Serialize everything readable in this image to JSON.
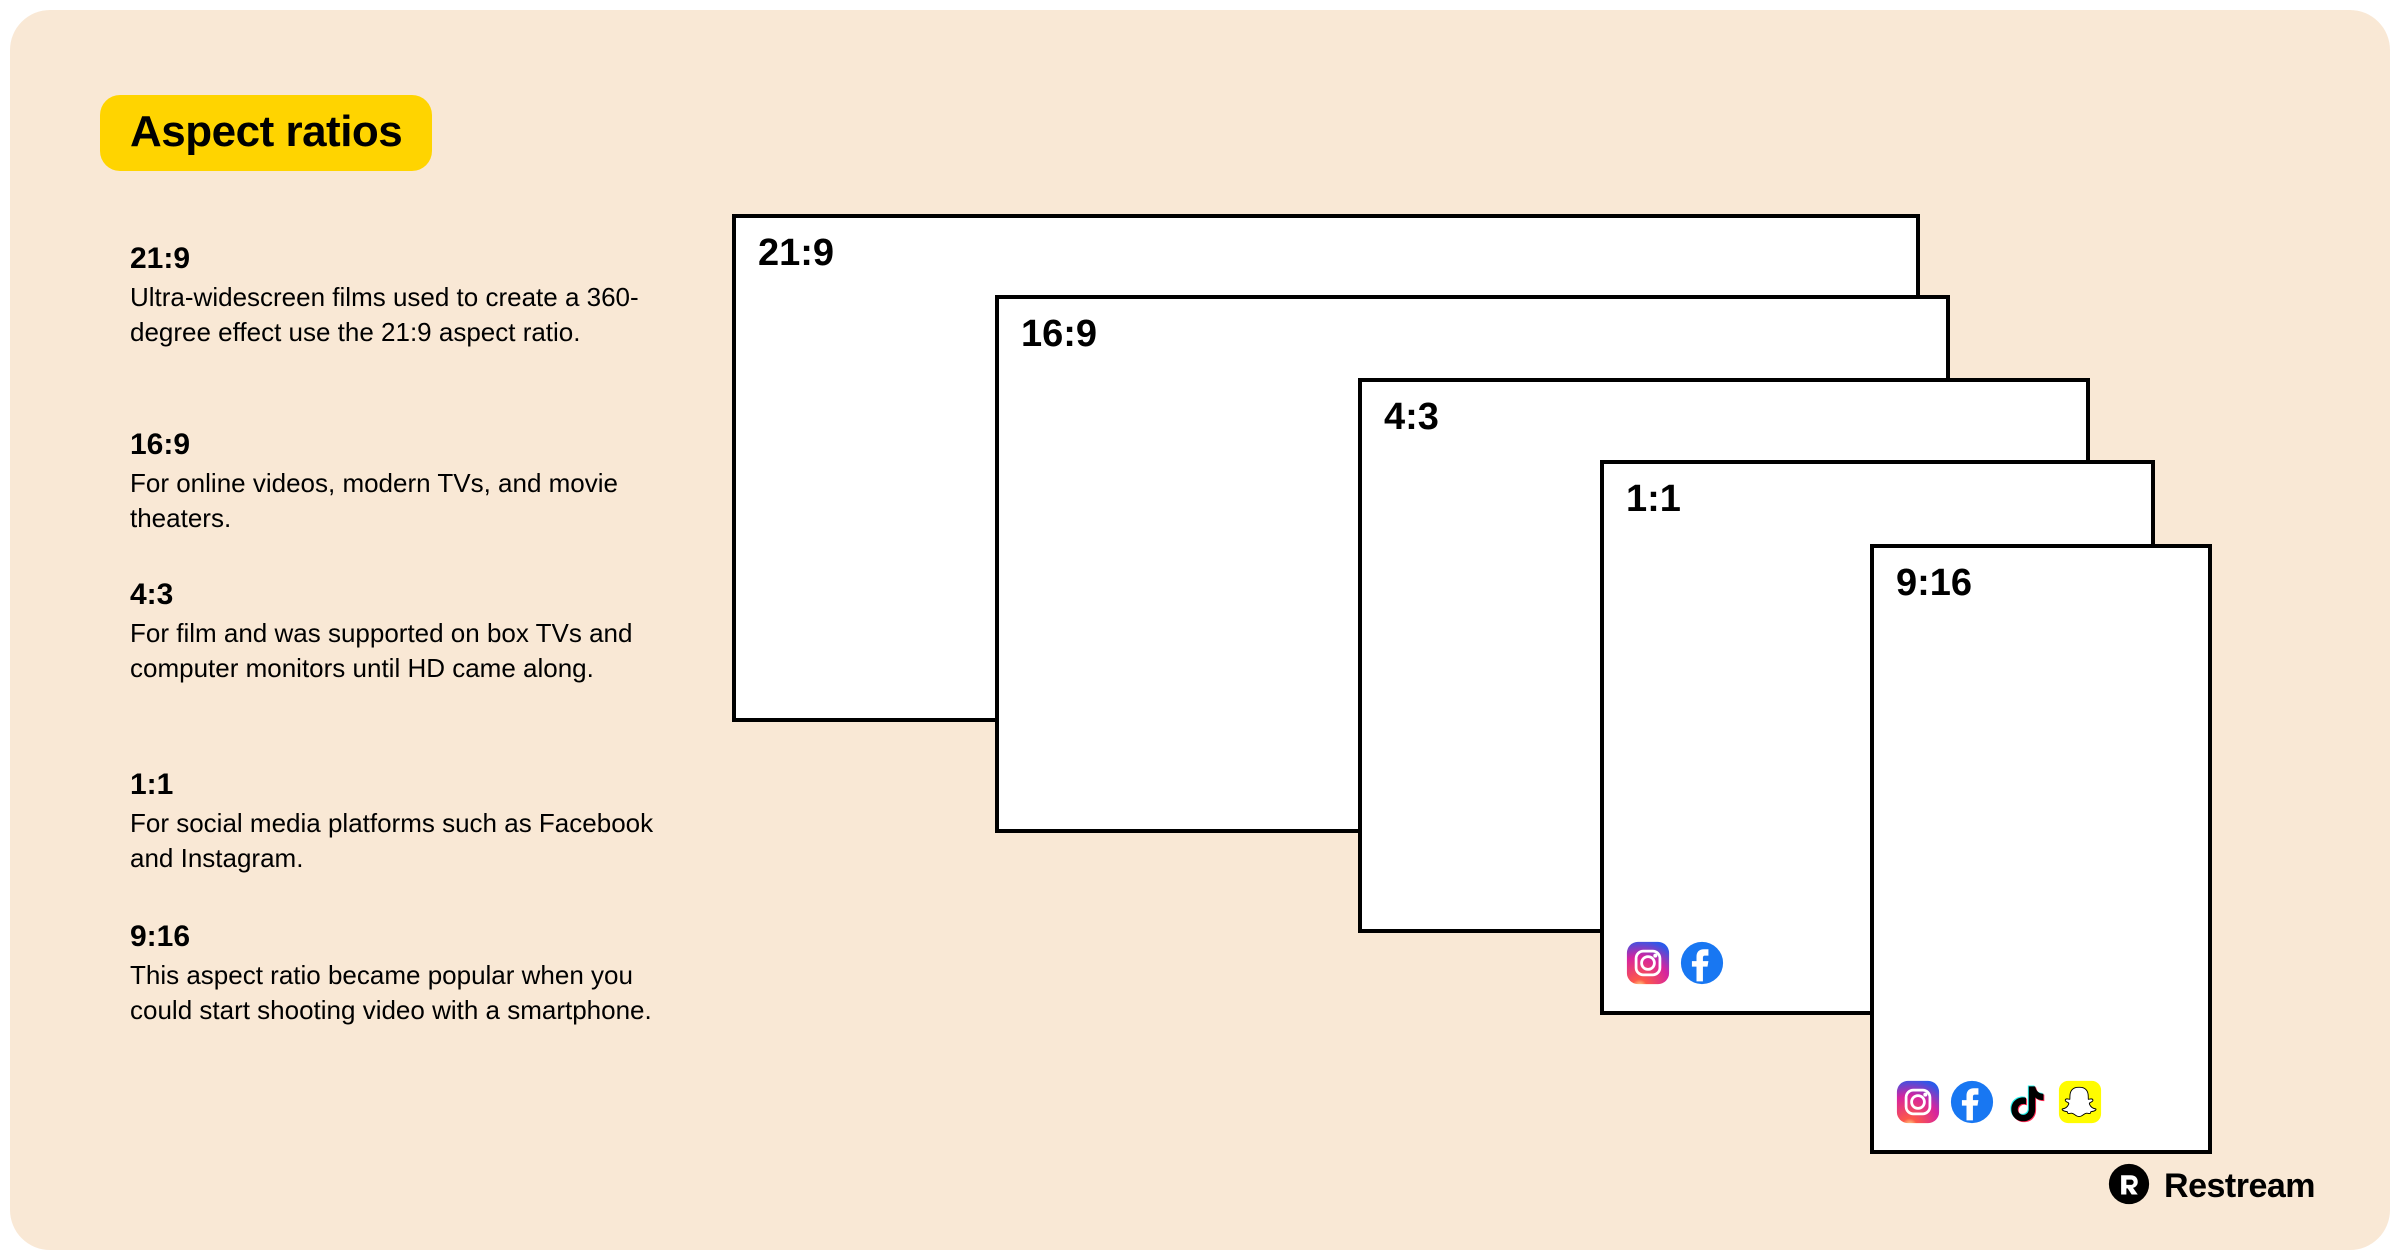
{
  "title": "Aspect ratios",
  "descriptions": [
    {
      "title": "21:9",
      "text": "Ultra-widescreen films used to create a 360-degree effect use the 21:9 aspect ratio."
    },
    {
      "title": "16:9",
      "text": "For online videos, modern TVs, and movie theaters."
    },
    {
      "title": "4:3",
      "text": "For film and was supported on box TVs and computer monitors until HD came along."
    },
    {
      "title": "1:1",
      "text": "For social media platforms such as Facebook and Instagram."
    },
    {
      "title": "9:16",
      "text": "This aspect ratio became popular when you could start shooting video with a smartphone."
    }
  ],
  "boxes": {
    "b0": {
      "label": "21:9"
    },
    "b1": {
      "label": "16:9"
    },
    "b2": {
      "label": "4:3"
    },
    "b3": {
      "label": "1:1"
    },
    "b4": {
      "label": "9:16"
    }
  },
  "icons": {
    "instagram": "instagram-icon",
    "facebook": "facebook-icon",
    "tiktok": "tiktok-icon",
    "snapchat": "snapchat-icon"
  },
  "brand": {
    "name": "Restream"
  },
  "colors": {
    "bg": "#f9e8d5",
    "accent": "#ffd400",
    "border": "#000000"
  }
}
